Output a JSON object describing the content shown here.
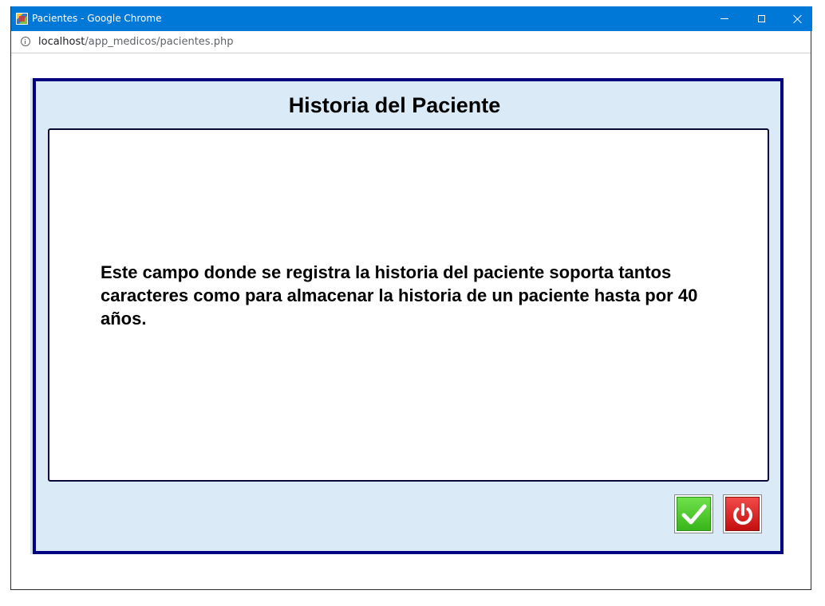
{
  "window": {
    "title": "Pacientes - Google Chrome",
    "url_host": "localhost",
    "url_path": "/app_medicos/pacientes.php"
  },
  "icons": {
    "app": "chrome-app-icon",
    "minimize": "minimize-icon",
    "maximize": "maximize-icon",
    "close": "close-icon",
    "info": "info-icon",
    "accept": "checkmark-icon",
    "exit": "power-icon"
  },
  "colors": {
    "titlebar": "#0078d7",
    "panel_border": "#000080",
    "panel_background": "#daeaf6",
    "accept_button": "#38b51c",
    "exit_button": "#c40f0f"
  },
  "panel": {
    "title": "Historia del Paciente",
    "history_text": "Este campo donde se registra la historia del paciente soporta tantos caracteres como para almacenar la historia de un paciente hasta por 40 años."
  }
}
